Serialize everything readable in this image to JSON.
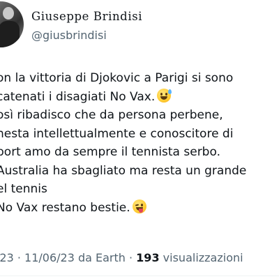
{
  "author": {
    "display_name": "Giuseppe Brindisi",
    "handle": "@giusbrindisi",
    "avatar_icon": "profile-photo"
  },
  "tweet": {
    "lines": [
      "on la vittoria di Djokovic a Parigi si sono",
      "catenati i disagiati No Vax.",
      "osì ribadisco che da persona perbene,",
      "nesta intellettualmente e conoscitore di",
      "port amo da sempre il tennista serbo.",
      " Australia ha sbagliato ma resta un grande",
      "el tennis",
      "No Vax restano bestie."
    ],
    "emoji_1": "grinning-sweat-emoji",
    "emoji_2": "winking-tongue-emoji"
  },
  "meta": {
    "time_date_source": ":23 · 11/06/23 da Earth ·",
    "view_count": "193",
    "views_label": "visualizzazioni"
  },
  "colors": {
    "text": "#0f1419",
    "secondary": "#536471"
  }
}
